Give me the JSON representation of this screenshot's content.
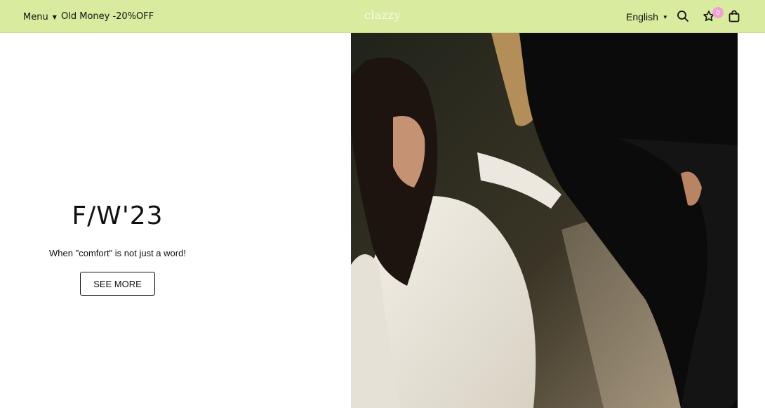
{
  "header": {
    "menu_label": "Menu",
    "promo_label": "Old Money -20%OFF",
    "logo": "clazzy",
    "language": "English",
    "wishlist_count": "0",
    "icons": [
      "search-icon",
      "star-icon",
      "shopping-bag-icon",
      "chevron-down-icon"
    ],
    "background_color": "#d9eb9e",
    "badge_color": "#f2a0d4"
  },
  "hero": {
    "title": "F/W'23",
    "subtitle": "When \"comfort\" is not just a word!",
    "cta_label": "SEE MORE"
  }
}
